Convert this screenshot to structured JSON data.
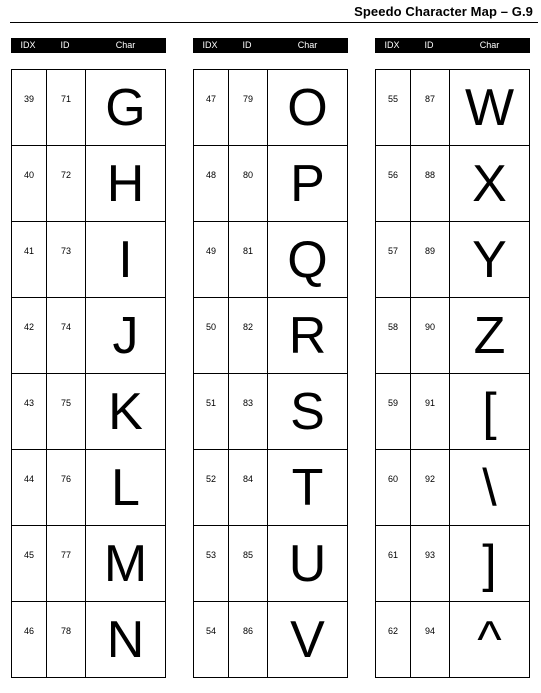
{
  "title": "Speedo Character Map – G.9",
  "headers": {
    "idx": "IDX",
    "id": "ID",
    "char": "Char"
  },
  "columns": [
    {
      "rows": [
        {
          "idx": "39",
          "id": "71",
          "char": "G"
        },
        {
          "idx": "40",
          "id": "72",
          "char": "H"
        },
        {
          "idx": "41",
          "id": "73",
          "char": "I"
        },
        {
          "idx": "42",
          "id": "74",
          "char": "J"
        },
        {
          "idx": "43",
          "id": "75",
          "char": "K"
        },
        {
          "idx": "44",
          "id": "76",
          "char": "L"
        },
        {
          "idx": "45",
          "id": "77",
          "char": "M"
        },
        {
          "idx": "46",
          "id": "78",
          "char": "N"
        }
      ]
    },
    {
      "rows": [
        {
          "idx": "47",
          "id": "79",
          "char": "O"
        },
        {
          "idx": "48",
          "id": "80",
          "char": "P"
        },
        {
          "idx": "49",
          "id": "81",
          "char": "Q"
        },
        {
          "idx": "50",
          "id": "82",
          "char": "R"
        },
        {
          "idx": "51",
          "id": "83",
          "char": "S"
        },
        {
          "idx": "52",
          "id": "84",
          "char": "T"
        },
        {
          "idx": "53",
          "id": "85",
          "char": "U"
        },
        {
          "idx": "54",
          "id": "86",
          "char": "V"
        }
      ]
    },
    {
      "rows": [
        {
          "idx": "55",
          "id": "87",
          "char": "W"
        },
        {
          "idx": "56",
          "id": "88",
          "char": "X"
        },
        {
          "idx": "57",
          "id": "89",
          "char": "Y"
        },
        {
          "idx": "58",
          "id": "90",
          "char": "Z"
        },
        {
          "idx": "59",
          "id": "91",
          "char": "["
        },
        {
          "idx": "60",
          "id": "92",
          "char": "\\"
        },
        {
          "idx": "61",
          "id": "93",
          "char": "]"
        },
        {
          "idx": "62",
          "id": "94",
          "char": "^"
        }
      ]
    }
  ]
}
